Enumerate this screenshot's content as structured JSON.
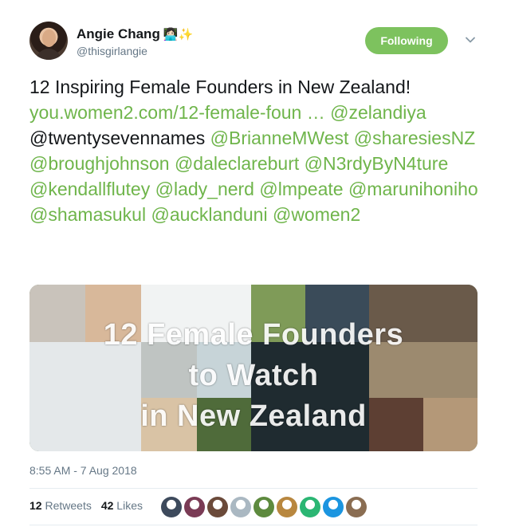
{
  "author": {
    "name": "Angie Chang",
    "name_emoji": "👩🏻‍💻✨",
    "handle": "@thisgirlangie"
  },
  "follow_button": {
    "label": "Following",
    "color": "#7dc25e"
  },
  "tweet": {
    "segments": [
      {
        "text": "12 Inspiring Female Founders in New Zealand! ",
        "link": false
      },
      {
        "text": "you.women2.com/12-female-foun …",
        "link": true
      },
      {
        "text": "  ",
        "link": false
      },
      {
        "text": "@zelandiya",
        "link": true
      },
      {
        "text": " @twentysevennames ",
        "link": false
      },
      {
        "text": "@BrianneMWest",
        "link": true
      },
      {
        "text": " ",
        "link": false
      },
      {
        "text": "@sharesiesNZ",
        "link": true
      },
      {
        "text": " ",
        "link": false
      },
      {
        "text": "@broughjohnson",
        "link": true
      },
      {
        "text": " ",
        "link": false
      },
      {
        "text": "@daleclareburt",
        "link": true
      },
      {
        "text": " ",
        "link": false
      },
      {
        "text": "@N3rdyByN4ture",
        "link": true
      },
      {
        "text": " ",
        "link": false
      },
      {
        "text": "@kendallflutey",
        "link": true
      },
      {
        "text": " ",
        "link": false
      },
      {
        "text": "@lady_nerd",
        "link": true
      },
      {
        "text": " ",
        "link": false
      },
      {
        "text": "@lmpeate",
        "link": true
      },
      {
        "text": "   ",
        "link": false
      },
      {
        "text": "@marunihoniho",
        "link": true
      },
      {
        "text": " ",
        "link": false
      },
      {
        "text": "@shamasukul",
        "link": true
      },
      {
        "text": " ",
        "link": false
      },
      {
        "text": "@aucklanduni",
        "link": true
      },
      {
        "text": " ",
        "link": false
      },
      {
        "text": "@women2",
        "link": true
      }
    ],
    "link_color": "#6fb54b"
  },
  "media": {
    "banner_lines": [
      "12 Female Founders",
      "to Watch",
      "in New Zealand"
    ]
  },
  "timestamp": "8:55 AM - 7 Aug 2018",
  "stats": {
    "retweets_count": "12",
    "retweets_label": "Retweets",
    "likes_count": "42",
    "likes_label": "Likes"
  },
  "likers": [
    {
      "name": "liker-avatar-1",
      "color": "#3d4a5c"
    },
    {
      "name": "liker-avatar-2",
      "color": "#7a3b55"
    },
    {
      "name": "liker-avatar-3",
      "color": "#6b4a3a"
    },
    {
      "name": "liker-avatar-4",
      "color": "#aab8c2"
    },
    {
      "name": "liker-avatar-5",
      "color": "#5d8a3e"
    },
    {
      "name": "liker-avatar-6",
      "color": "#b8873f"
    },
    {
      "name": "liker-avatar-7",
      "color": "#2bb673"
    },
    {
      "name": "liker-avatar-8",
      "color": "#1b95e0"
    },
    {
      "name": "liker-avatar-9",
      "color": "#8a6d52"
    }
  ]
}
